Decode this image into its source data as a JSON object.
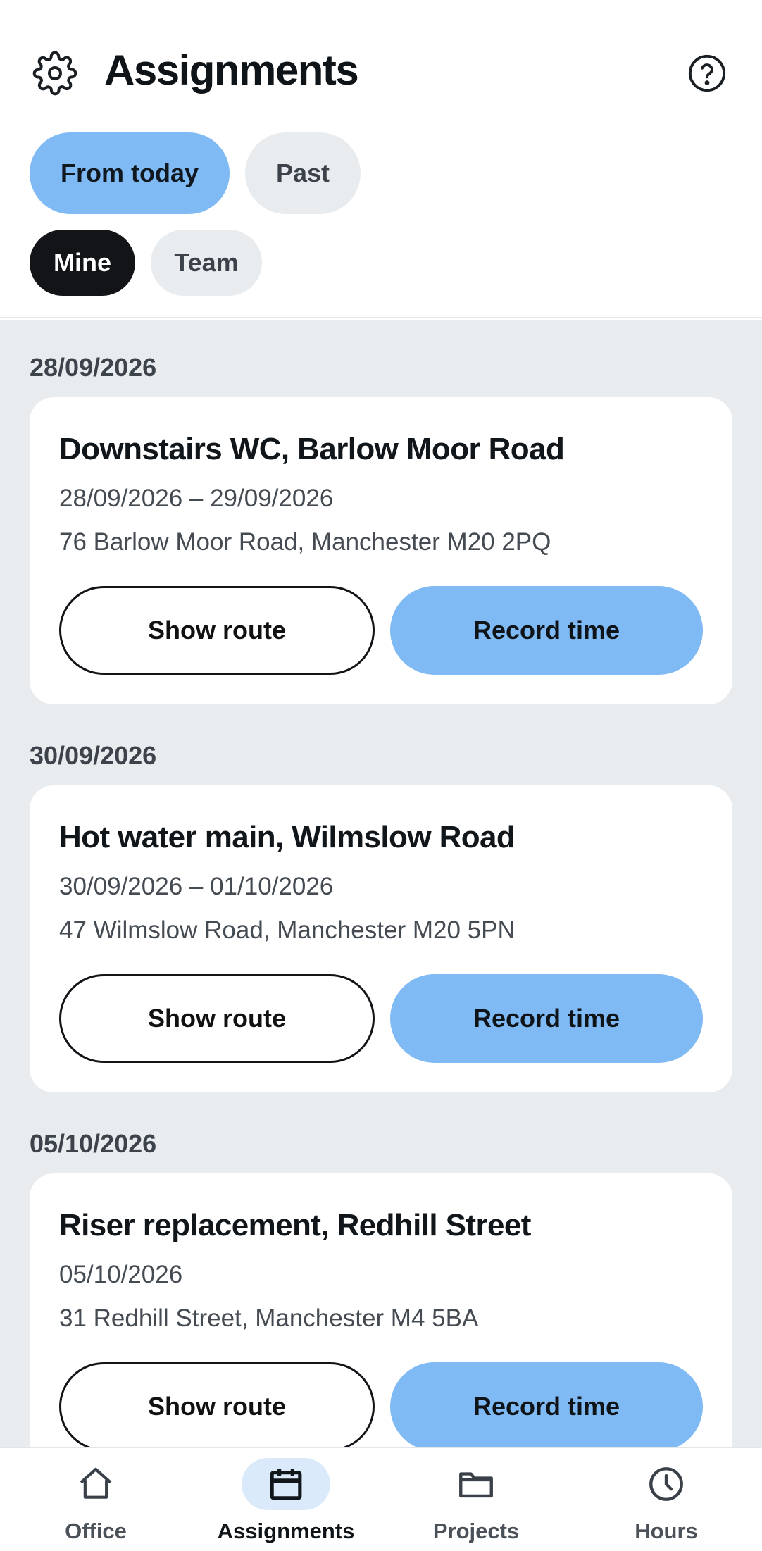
{
  "header": {
    "title": "Assignments",
    "settings_icon": "gear-icon",
    "help_icon": "help-icon"
  },
  "filters": {
    "period": [
      {
        "label": "From today",
        "selected": true
      },
      {
        "label": "Past",
        "selected": false
      }
    ],
    "scope": [
      {
        "label": "Mine",
        "selected": true
      },
      {
        "label": "Team",
        "selected": false
      }
    ]
  },
  "assignments": [
    {
      "date": "28/09/2026",
      "title": "Downstairs WC, Barlow Moor Road",
      "dates": "28/09/2026 – 29/09/2026",
      "address": "76 Barlow Moor Road, Manchester M20 2PQ",
      "route_label": "Show route",
      "record_label": "Record time"
    },
    {
      "date": "30/09/2026",
      "title": "Hot water main, Wilmslow Road",
      "dates": "30/09/2026 – 01/10/2026",
      "address": "47 Wilmslow Road, Manchester M20 5PN",
      "route_label": "Show route",
      "record_label": "Record time"
    },
    {
      "date": "05/10/2026",
      "title": "Riser replacement, Redhill Street",
      "dates": "05/10/2026",
      "address": "31 Redhill Street, Manchester M4 5BA",
      "route_label": "Show route",
      "record_label": "Record time"
    }
  ],
  "nav": {
    "items": [
      {
        "label": "Office",
        "icon": "home-icon",
        "active": false
      },
      {
        "label": "Assignments",
        "icon": "calendar-icon",
        "active": true
      },
      {
        "label": "Projects",
        "icon": "folder-icon",
        "active": false
      },
      {
        "label": "Hours",
        "icon": "clock-icon",
        "active": false
      }
    ]
  },
  "colors": {
    "accent": "#7fbaf4",
    "dark_chip": "#121418",
    "feed_background": "#e9ecef",
    "nav_active_pill": "#dbeafb"
  }
}
